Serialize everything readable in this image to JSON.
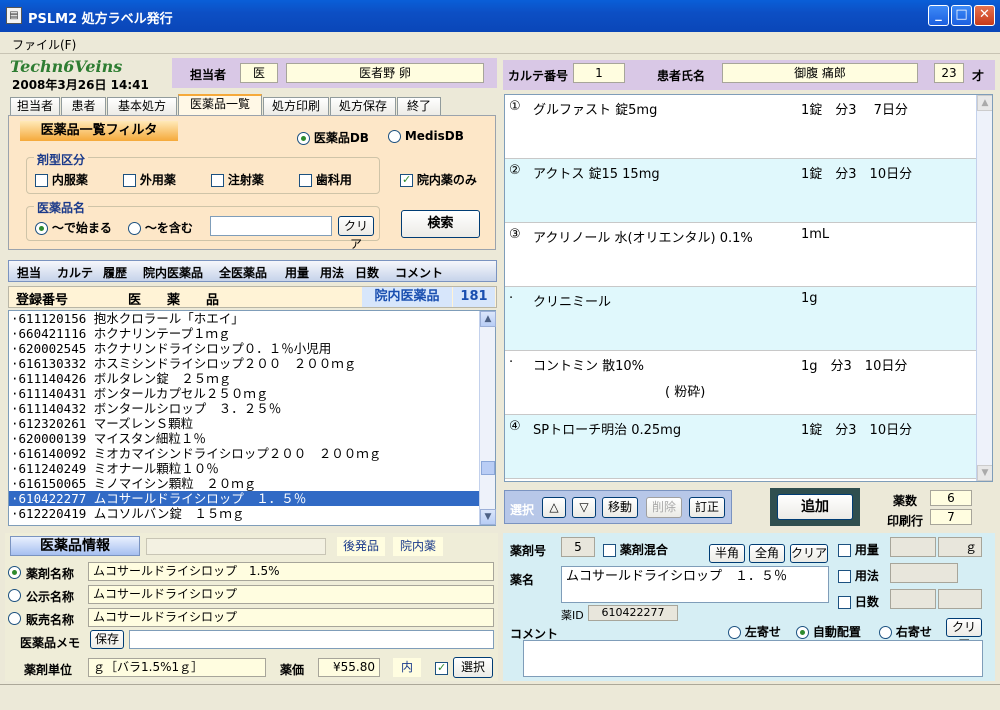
{
  "window": {
    "title": "PSLM2 処方ラベル発行",
    "icon": "document-icon"
  },
  "menu": {
    "file": "ファイル(F)"
  },
  "header": {
    "logo": "Techn6Veins",
    "datetime": "2008年3月26日 14:41",
    "staff_label": "担当者",
    "staff_role": "医",
    "staff_name": "医者野 卵"
  },
  "tabs": [
    "担当者",
    "患者",
    "基本処方",
    "医薬品一覧",
    "処方印刷",
    "処方保存",
    "終了"
  ],
  "filter": {
    "title": "医薬品一覧フィルタ",
    "db_options": [
      "医薬品DB",
      "MedisDB"
    ],
    "form_label": "剤型区分",
    "forms": [
      "内服薬",
      "外用薬",
      "注射薬",
      "歯科用"
    ],
    "hospital_only": "院内薬のみ",
    "name_label": "医薬品名",
    "match_options": [
      "～で始まる",
      "～を含む"
    ],
    "clear": "クリア",
    "search": "検索"
  },
  "toolbar": [
    "担当",
    "カルテ",
    "履歴",
    "院内医薬品",
    "全医薬品",
    "用量",
    "用法",
    "日数",
    "コメント"
  ],
  "list": {
    "col_code": "登録番号",
    "col_name": "医　　薬　　品",
    "filter_label": "院内医薬品",
    "count": "181",
    "rows": [
      "·611120156 抱水クロラール「ホエイ」",
      "·660421116 ホクナリンテープ１ｍｇ",
      "·620002545 ホクナリンドライシロップ０．１％小児用",
      "·616130332 ホスミシンドライシロップ２００　２００ｍｇ",
      "·611140426 ボルタレン錠　２５ｍｇ",
      "·611140431 ボンタールカプセル２５０ｍｇ",
      "·611140432 ボンタールシロップ　３．２５％",
      "·612320261 マーズレンＳ顆粒",
      "·620000139 マイスタン細粒１％",
      "·616140092 ミオカマイシンドライシロップ２００　２００ｍｇ",
      "·611240249 ミオナール顆粒１０％",
      "·616150065 ミノマイシン顆粒　２０ｍｇ",
      "·610422277 ムコサールドライシロップ　１．５％",
      "·612220419 ムコソルバン錠　１５ｍｇ"
    ],
    "selected_index": 12
  },
  "drug_info": {
    "title": "医薬品情報",
    "generic_btn": "後発品",
    "inhouse_btn": "院内薬",
    "name_options": [
      "薬剤名称",
      "公示名称",
      "販売名称"
    ],
    "names": [
      "ムコサールドライシロップ　1.5%",
      "ムコサールドライシロップ",
      "ムコサールドライシロップ"
    ],
    "memo_label": "医薬品メモ",
    "save": "保存",
    "unit_label": "薬剤単位",
    "unit": "ｇ［バラ1.5%1ｇ］",
    "price_label": "薬価",
    "price": "¥55.80",
    "price_flag": "内",
    "select": "選択"
  },
  "patient": {
    "chart_label": "カルテ番号",
    "chart_no": "1",
    "name_label": "患者氏名",
    "name": "御腹 痛郎",
    "age": "23",
    "age_unit": "才"
  },
  "prescriptions": [
    {
      "no": "①",
      "name": "グルファスト 錠5mg",
      "dose": "1錠　分3　 7日分",
      "note": ""
    },
    {
      "no": "②",
      "name": "アクトス 錠15 15mg",
      "dose": "1錠　分3　10日分",
      "note": ""
    },
    {
      "no": "③",
      "name": "アクリノール 水(オリエンタル) 0.1%",
      "dose": "1mL",
      "note": ""
    },
    {
      "no": "·",
      "name": "クリニミール",
      "dose": "1g",
      "note": ""
    },
    {
      "no": "·",
      "name": "コントミン 散10%",
      "dose": "1g　分3　10日分",
      "note": "( 粉砕)"
    },
    {
      "no": "④",
      "name": "SPトローチ明治 0.25mg",
      "dose": "1錠　分3　10日分",
      "note": ""
    }
  ],
  "controls": {
    "select": "選択",
    "up": "△",
    "down": "▽",
    "move": "移動",
    "delete": "削除",
    "revise": "訂正",
    "add": "追加",
    "count_label": "薬数",
    "count": "6",
    "rows_label": "印刷行",
    "rows": "7"
  },
  "editor": {
    "no_label": "薬剤号",
    "no": "5",
    "mix": "薬剤混合",
    "half": "半角",
    "full": "全角",
    "clear": "クリア",
    "name_label": "薬名",
    "name": "ムコサールドライシロップ　１．５％",
    "id_label": "薬ID",
    "id": "610422277",
    "dose_label": "用量",
    "dose_unit": "ｇ",
    "usage_label": "用法",
    "days_label": "日数",
    "comment_label": "コメント",
    "align": [
      "左寄せ",
      "自動配置",
      "右寄せ"
    ],
    "comment_clear": "クリア"
  },
  "colors": {
    "titlebar": "#0a5fd8",
    "filter_bg": "#fde7c8",
    "header_purple": "#d9c8e6",
    "selection": "#316ac5",
    "rx_alt": "#e0f8fc",
    "editor_bg": "#d6eef4"
  }
}
